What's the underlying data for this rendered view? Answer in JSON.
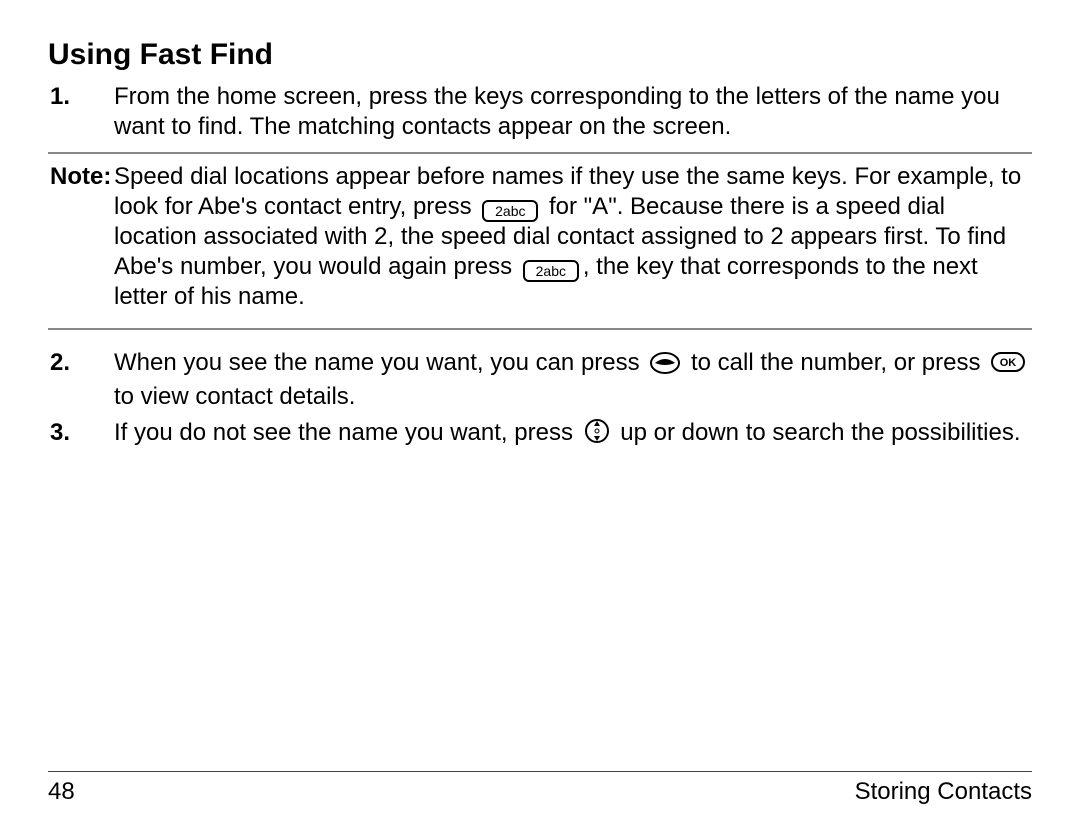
{
  "heading": "Using Fast Find",
  "steps": {
    "n1": "1.",
    "t1": "From the home screen, press the keys corresponding to the letters of the name you want to find. The matching contacts appear on the screen.",
    "n2": "2.",
    "t2a": "When you see the name you want, you can press ",
    "t2b": " to call the number, or press ",
    "t2c": " to view contact details.",
    "n3": "3.",
    "t3a": "If you do not see the name you want, press ",
    "t3b": " up or down to search the possibilities."
  },
  "note": {
    "label": "Note:",
    "a": "Speed dial locations appear before names if they use the same keys. For example, to look for Abe's contact entry, press ",
    "b": " for \"A\". Because there is a speed dial location associated with 2, the speed dial contact assigned to 2 appears first. To find Abe's number, you would again press ",
    "c": ", the key that corresponds to the next letter of his name."
  },
  "icons": {
    "key2": "2abc"
  },
  "footer": {
    "page": "48",
    "section": "Storing Contacts"
  }
}
